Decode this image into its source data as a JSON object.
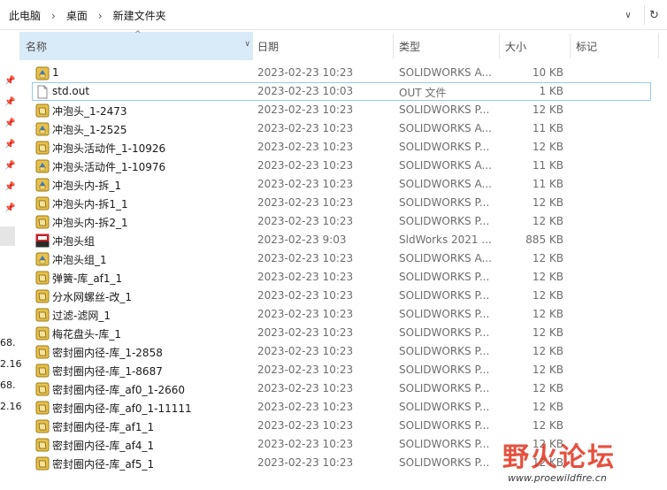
{
  "address_bar": {
    "crumbs": [
      "此电脑",
      "桌面",
      "新建文件夹"
    ],
    "separator": "›",
    "dropdown_glyph": "∨",
    "refresh_glyph": "↻"
  },
  "left_strip": {
    "cut_texts": [
      "68.",
      "2.16",
      "68.",
      "2.16"
    ]
  },
  "columns": {
    "name": "名称",
    "date": "日期",
    "type": "类型",
    "size": "大小",
    "tags": "标记",
    "sort_glyph": "^",
    "chevron_glyph": "∨"
  },
  "files": [
    {
      "name": "1",
      "date": "2023-02-23 10:23",
      "type": "SOLIDWORKS A...",
      "size": "10 KB",
      "icon": "solidworks-assembly-icon"
    },
    {
      "name": "std.out",
      "date": "2023-02-23 10:03",
      "type": "OUT 文件",
      "size": "1 KB",
      "icon": "document-icon"
    },
    {
      "name": "冲泡头_1-2473",
      "date": "2023-02-23 10:23",
      "type": "SOLIDWORKS P...",
      "size": "12 KB",
      "icon": "solidworks-part-icon"
    },
    {
      "name": "冲泡头_1-2525",
      "date": "2023-02-23 10:23",
      "type": "SOLIDWORKS A...",
      "size": "11 KB",
      "icon": "solidworks-assembly-icon"
    },
    {
      "name": "冲泡头活动件_1-10926",
      "date": "2023-02-23 10:23",
      "type": "SOLIDWORKS P...",
      "size": "12 KB",
      "icon": "solidworks-part-icon"
    },
    {
      "name": "冲泡头活动件_1-10976",
      "date": "2023-02-23 10:23",
      "type": "SOLIDWORKS A...",
      "size": "11 KB",
      "icon": "solidworks-assembly-icon"
    },
    {
      "name": "冲泡头内-拆_1",
      "date": "2023-02-23 10:23",
      "type": "SOLIDWORKS A...",
      "size": "11 KB",
      "icon": "solidworks-assembly-icon"
    },
    {
      "name": "冲泡头内-拆1_1",
      "date": "2023-02-23 10:23",
      "type": "SOLIDWORKS P...",
      "size": "12 KB",
      "icon": "solidworks-part-icon"
    },
    {
      "name": "冲泡头内-拆2_1",
      "date": "2023-02-23 10:23",
      "type": "SOLIDWORKS P...",
      "size": "12 KB",
      "icon": "solidworks-part-icon"
    },
    {
      "name": "冲泡头组",
      "date": "2023-02-23 9:03",
      "type": "SldWorks 2021 ...",
      "size": "885 KB",
      "icon": "sldworks-2021-icon"
    },
    {
      "name": "冲泡头组_1",
      "date": "2023-02-23 10:23",
      "type": "SOLIDWORKS A...",
      "size": "12 KB",
      "icon": "solidworks-assembly-icon"
    },
    {
      "name": "弹簧-库_af1_1",
      "date": "2023-02-23 10:23",
      "type": "SOLIDWORKS P...",
      "size": "12 KB",
      "icon": "solidworks-part-icon"
    },
    {
      "name": "分水网螺丝-改_1",
      "date": "2023-02-23 10:23",
      "type": "SOLIDWORKS P...",
      "size": "12 KB",
      "icon": "solidworks-part-icon"
    },
    {
      "name": "过滤-滤网_1",
      "date": "2023-02-23 10:23",
      "type": "SOLIDWORKS P...",
      "size": "12 KB",
      "icon": "solidworks-part-icon"
    },
    {
      "name": "梅花盘头-库_1",
      "date": "2023-02-23 10:23",
      "type": "SOLIDWORKS P...",
      "size": "12 KB",
      "icon": "solidworks-part-icon"
    },
    {
      "name": "密封圈内径-库_1-2858",
      "date": "2023-02-23 10:23",
      "type": "SOLIDWORKS P...",
      "size": "12 KB",
      "icon": "solidworks-part-icon"
    },
    {
      "name": "密封圈内径-库_1-8687",
      "date": "2023-02-23 10:23",
      "type": "SOLIDWORKS P...",
      "size": "12 KB",
      "icon": "solidworks-part-icon"
    },
    {
      "name": "密封圈内径-库_af0_1-2660",
      "date": "2023-02-23 10:23",
      "type": "SOLIDWORKS P...",
      "size": "12 KB",
      "icon": "solidworks-part-icon"
    },
    {
      "name": "密封圈内径-库_af0_1-11111",
      "date": "2023-02-23 10:23",
      "type": "SOLIDWORKS P...",
      "size": "12 KB",
      "icon": "solidworks-part-icon"
    },
    {
      "name": "密封圈内径-库_af1_1",
      "date": "2023-02-23 10:23",
      "type": "SOLIDWORKS P...",
      "size": "12 KB",
      "icon": "solidworks-part-icon"
    },
    {
      "name": "密封圈内径-库_af4_1",
      "date": "2023-02-23 10:23",
      "type": "SOLIDWORKS P...",
      "size": "12 KB",
      "icon": "solidworks-part-icon"
    },
    {
      "name": "密封圈内径-库_af5_1",
      "date": "2023-02-23 10:23",
      "type": "SOLIDWORKS P...",
      "size": "12 KB",
      "icon": "solidworks-part-icon"
    }
  ],
  "watermark": {
    "title": "野火论坛",
    "url": "www.proewildfire.cn"
  }
}
